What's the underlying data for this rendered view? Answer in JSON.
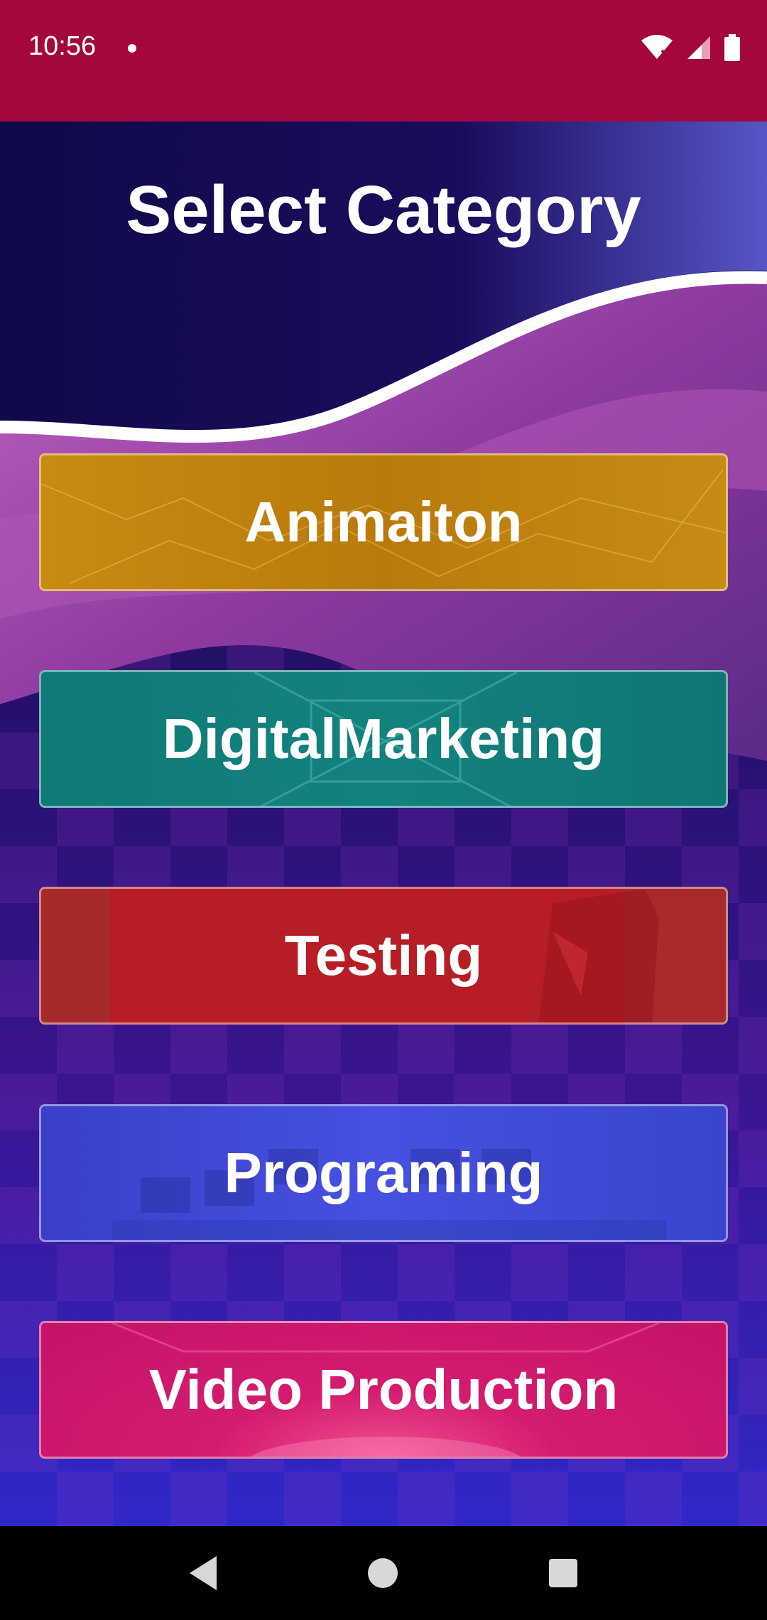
{
  "status_bar": {
    "time": "10:56",
    "background": "#a5073a"
  },
  "page": {
    "title": "Select Category"
  },
  "categories": [
    {
      "label": "Animaiton",
      "color": "#c2820f"
    },
    {
      "label": "DigitalMarketing",
      "color": "#12807c"
    },
    {
      "label": "Testing",
      "color": "#b71d24"
    },
    {
      "label": "Programing",
      "color": "#4350dc"
    },
    {
      "label": "Video Production",
      "color": "#cc1a6e"
    }
  ],
  "nav_bar": {
    "icons": [
      "back-icon",
      "home-icon",
      "recents-icon"
    ]
  }
}
